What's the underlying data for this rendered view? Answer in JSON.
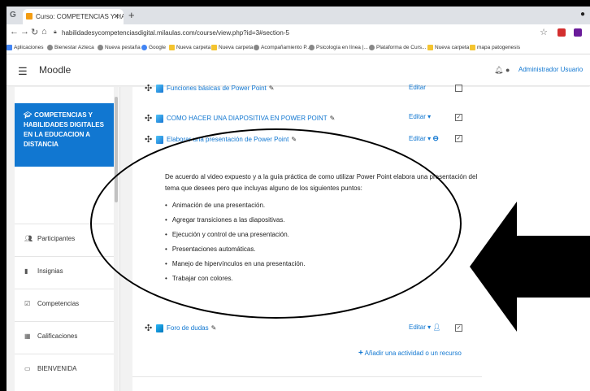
{
  "browser": {
    "tab_title": "Curso: COMPETENCIAS Y HABILI",
    "url": "habilidadesycompetenciasdigital.milaulas.com/course/view.php?id=3#section-5",
    "bookmarks": [
      {
        "label": "Aplicaciones",
        "icon": "apps-icon"
      },
      {
        "label": "Bienestar Azteca",
        "icon": "web-icon"
      },
      {
        "label": "Nueva pestaña",
        "icon": "web-icon"
      },
      {
        "label": "Google",
        "icon": "google-icon"
      },
      {
        "label": "Nueva carpeta",
        "icon": "folder-icon"
      },
      {
        "label": "Nueva carpeta",
        "icon": "folder-icon"
      },
      {
        "label": "Acompañamiento P...",
        "icon": "web-icon"
      },
      {
        "label": "Psicología en línea |...",
        "icon": "web-icon"
      },
      {
        "label": "Plataforma de Curs...",
        "icon": "web-icon"
      },
      {
        "label": "Nueva carpeta",
        "icon": "folder-icon"
      },
      {
        "label": "mapa patogenesis",
        "icon": "folder-icon"
      }
    ]
  },
  "header": {
    "brand": "Moodle",
    "user": "Administrador Usuario"
  },
  "drawer": {
    "course_name": "COMPETENCIAS Y HABILIDADES DIGITALES EN LA EDUCACION A DISTANCIA",
    "items": [
      {
        "label": "Participantes",
        "icon": "users-icon"
      },
      {
        "label": "Insignias",
        "icon": "badge-icon"
      },
      {
        "label": "Competencias",
        "icon": "check-icon"
      },
      {
        "label": "Calificaciones",
        "icon": "table-icon"
      },
      {
        "label": "BIENVENIDA",
        "icon": "folder-icon"
      }
    ]
  },
  "activities": {
    "a0": "Funciones básicas de Power Point",
    "a1": "COMO HACER UNA DIAPOSITIVA EN POWER POINT",
    "a2": "Elaborar una presentación de Power Point",
    "a3": "Foro de dudas",
    "edit_label": "Editar"
  },
  "description": {
    "intro": "De acuerdo al video expuesto y a la guía práctica de como utilizar Power Point elabora una presentación del tema que desees pero que incluyas alguno de los siguientes puntos:",
    "points": [
      "Animación de una presentación.",
      "Agregar transiciones a las diapositivas.",
      "Ejecución y control de una presentación.",
      "Presentaciones automáticas.",
      "Manejo de hipervínculos en una presentación.",
      "Trabajar con colores."
    ]
  },
  "add_activity": "Añadir una actividad o un recurso"
}
